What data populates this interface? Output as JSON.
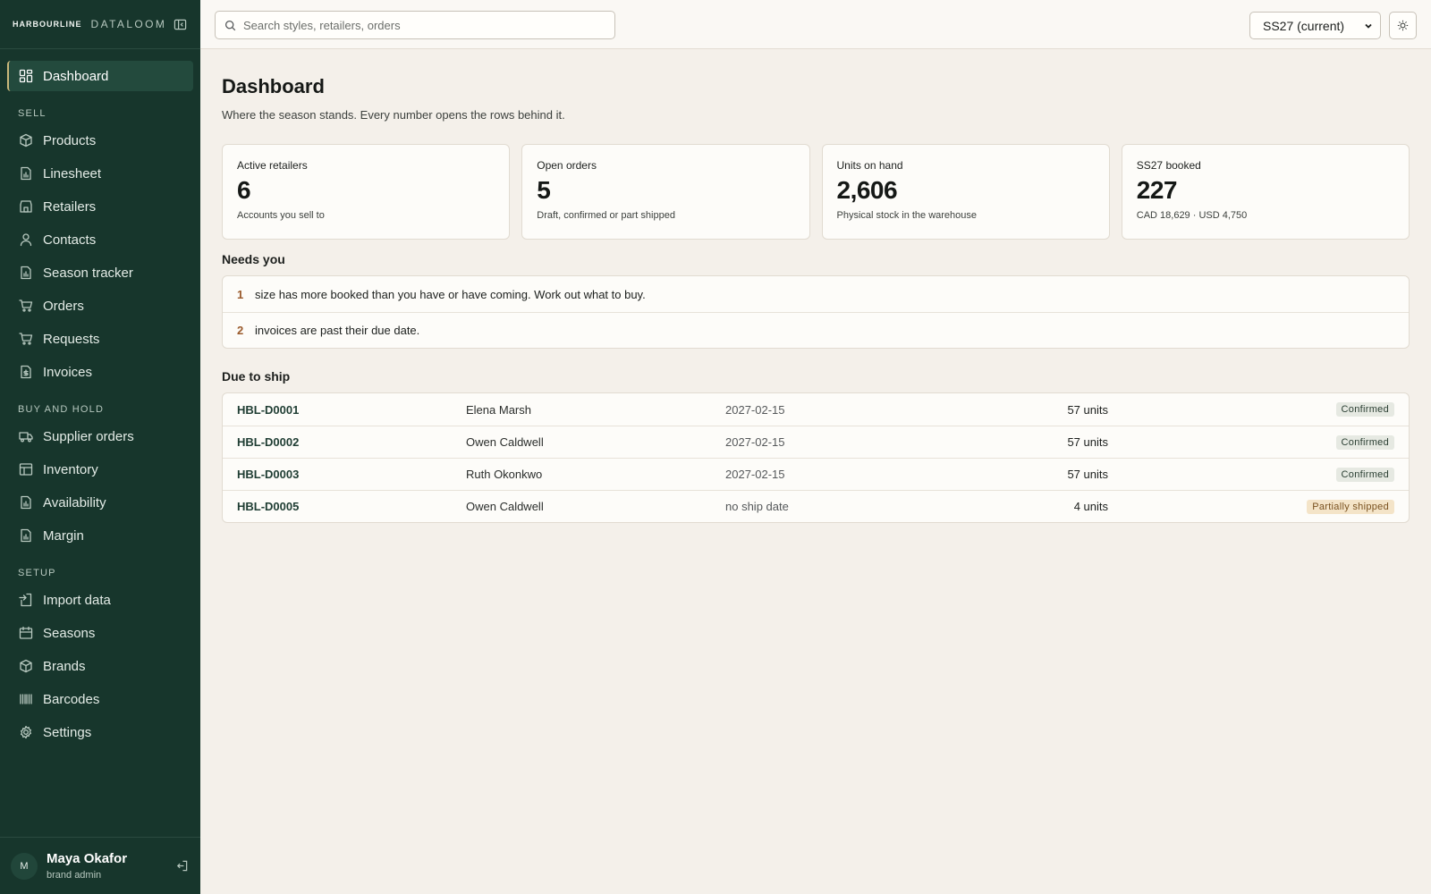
{
  "brand": {
    "name": "HARBOURLINE",
    "product": "DATALOOM"
  },
  "sidebar": {
    "dashboard": {
      "label": "Dashboard",
      "icon": "dashboard-icon"
    },
    "sections": [
      {
        "label": "SELL",
        "items": [
          {
            "label": "Products",
            "icon": "box-icon"
          },
          {
            "label": "Linesheet",
            "icon": "file-chart-icon"
          },
          {
            "label": "Retailers",
            "icon": "store-icon"
          },
          {
            "label": "Contacts",
            "icon": "user-icon"
          },
          {
            "label": "Season tracker",
            "icon": "file-chart-icon"
          },
          {
            "label": "Orders",
            "icon": "cart-icon"
          },
          {
            "label": "Requests",
            "icon": "cart-icon"
          },
          {
            "label": "Invoices",
            "icon": "invoice-icon"
          }
        ]
      },
      {
        "label": "BUY AND HOLD",
        "items": [
          {
            "label": "Supplier orders",
            "icon": "truck-icon"
          },
          {
            "label": "Inventory",
            "icon": "table-icon"
          },
          {
            "label": "Availability",
            "icon": "file-chart-icon"
          },
          {
            "label": "Margin",
            "icon": "file-chart-icon"
          }
        ]
      },
      {
        "label": "SETUP",
        "items": [
          {
            "label": "Import data",
            "icon": "import-icon"
          },
          {
            "label": "Seasons",
            "icon": "calendar-icon"
          },
          {
            "label": "Brands",
            "icon": "box-icon"
          },
          {
            "label": "Barcodes",
            "icon": "barcode-icon"
          },
          {
            "label": "Settings",
            "icon": "gear-icon"
          }
        ]
      }
    ]
  },
  "user": {
    "initial": "M",
    "name": "Maya Okafor",
    "role": "brand admin"
  },
  "topbar": {
    "search_placeholder": "Search styles, retailers, orders",
    "season_selected": "SS27 (current)"
  },
  "page": {
    "title": "Dashboard",
    "subtitle": "Where the season stands. Every number opens the rows behind it."
  },
  "stats": [
    {
      "label": "Active retailers",
      "value": "6",
      "note": "Accounts you sell to"
    },
    {
      "label": "Open orders",
      "value": "5",
      "note": "Draft, confirmed or part shipped"
    },
    {
      "label": "Units on hand",
      "value": "2,606",
      "note": "Physical stock in the warehouse"
    },
    {
      "label": "SS27 booked",
      "value": "227",
      "note": "CAD 18,629 · USD 4,750"
    }
  ],
  "needs_you": {
    "title": "Needs you",
    "items": [
      {
        "count": "1",
        "text": "size has more booked than you have or have coming. Work out what to buy."
      },
      {
        "count": "2",
        "text": "invoices are past their due date."
      }
    ]
  },
  "due_to_ship": {
    "title": "Due to ship",
    "rows": [
      {
        "id": "HBL-D0001",
        "retailer": "Elena Marsh",
        "date": "2027-02-15",
        "units": "57 units",
        "status": "Confirmed",
        "status_kind": "confirmed"
      },
      {
        "id": "HBL-D0002",
        "retailer": "Owen Caldwell",
        "date": "2027-02-15",
        "units": "57 units",
        "status": "Confirmed",
        "status_kind": "confirmed"
      },
      {
        "id": "HBL-D0003",
        "retailer": "Ruth Okonkwo",
        "date": "2027-02-15",
        "units": "57 units",
        "status": "Confirmed",
        "status_kind": "confirmed"
      },
      {
        "id": "HBL-D0005",
        "retailer": "Owen Caldwell",
        "date": "no ship date",
        "units": "4 units",
        "status": "Partially shipped",
        "status_kind": "partial"
      }
    ]
  },
  "colors": {
    "sidebar_bg": "#17362c",
    "active_accent": "#c9b77a",
    "page_bg": "#f4f0ea",
    "status_confirmed_bg": "#e6e9e2",
    "status_partial_bg": "#f4e4c8",
    "needs_count": "#9a5a2c"
  }
}
